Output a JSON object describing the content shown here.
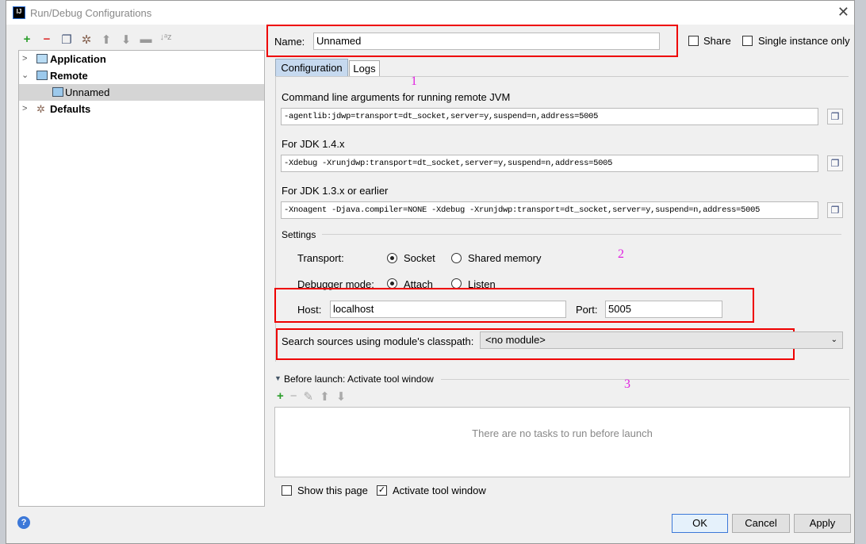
{
  "window": {
    "title": "Run/Debug Configurations",
    "logo": "IJ"
  },
  "toolbar": {
    "icons": [
      "plus-icon",
      "minus-icon",
      "copy-icon",
      "wrench-icon",
      "arrow-up-icon",
      "arrow-down-icon",
      "folder-icon",
      "sort-az-icon"
    ]
  },
  "tree": [
    {
      "label": "Application",
      "expanded": false
    },
    {
      "label": "Remote",
      "expanded": true
    },
    {
      "label": "Unnamed",
      "selected": true
    },
    {
      "label": "Defaults",
      "expanded": false
    }
  ],
  "name": {
    "label": "Name:",
    "value": "Unnamed"
  },
  "share": {
    "label": "Share",
    "checked": false
  },
  "single_instance": {
    "label": "Single instance only",
    "checked": false
  },
  "tabs": [
    {
      "label": "Configuration",
      "active": true
    },
    {
      "label": "Logs"
    }
  ],
  "annotations": [
    "1",
    "2",
    "3"
  ],
  "config": {
    "cmd_label": "Command line arguments for running remote JVM",
    "cmd_value": "-agentlib:jdwp=transport=dt_socket,server=y,suspend=n,address=5005",
    "jdk14_label": "For JDK 1.4.x",
    "jdk14_value": "-Xdebug -Xrunjdwp:transport=dt_socket,server=y,suspend=n,address=5005",
    "jdk13_label": "For JDK 1.3.x or earlier",
    "jdk13_value": "-Xnoagent -Djava.compiler=NONE -Xdebug -Xrunjdwp:transport=dt_socket,server=y,suspend=n,address=5005"
  },
  "settings": {
    "title": "Settings",
    "transport_label": "Transport:",
    "transport_options": [
      "Socket",
      "Shared memory"
    ],
    "transport_selected": "Socket",
    "mode_label": "Debugger mode:",
    "mode_options": [
      "Attach",
      "Listen"
    ],
    "mode_selected": "Attach",
    "host_label": "Host:",
    "host_value": "localhost",
    "port_label": "Port:",
    "port_value": "5005",
    "module_label": "Search sources using module's classpath:",
    "module_value": "<no module>"
  },
  "before_launch": {
    "title": "Before launch: Activate tool window",
    "empty_text": "There are no tasks to run before launch"
  },
  "show_page": {
    "label": "Show this page",
    "checked": false
  },
  "activate_tool": {
    "label": "Activate tool window",
    "checked": true
  },
  "buttons": {
    "ok": "OK",
    "cancel": "Cancel",
    "apply": "Apply",
    "help": "?"
  },
  "colors": {
    "accent": "#3c78d8",
    "annotation_box": "#ee0000",
    "annotation_text": "#e020e0"
  }
}
